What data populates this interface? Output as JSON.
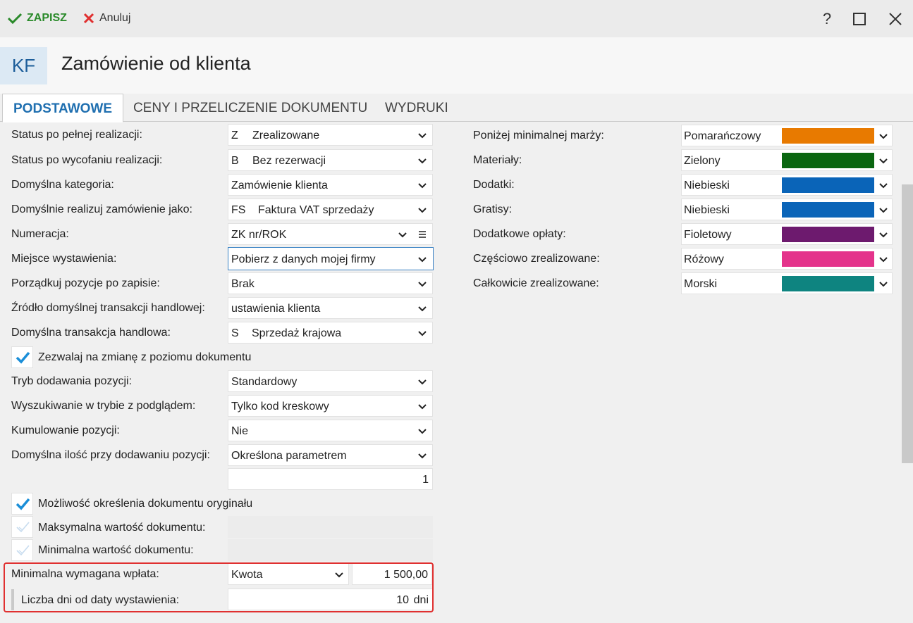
{
  "toolbar": {
    "save_label": "ZAPISZ",
    "cancel_label": "Anuluj",
    "help_label": "?"
  },
  "header": {
    "badge": "KF",
    "title": "Zamówienie od klienta"
  },
  "tabs": [
    {
      "label": "PODSTAWOWE",
      "active": true
    },
    {
      "label": "CENY I PRZELICZENIE DOKUMENTU",
      "active": false
    },
    {
      "label": "WYDRUKI",
      "active": false
    }
  ],
  "left": {
    "status_full": {
      "label": "Status po pełnej realizacji:",
      "code": "Z",
      "value": "Zrealizowane"
    },
    "status_withdraw": {
      "label": "Status po wycofaniu realizacji:",
      "code": "B",
      "value": "Bez rezerwacji"
    },
    "default_category": {
      "label": "Domyślna kategoria:",
      "value": "Zamówienie klienta"
    },
    "realize_as": {
      "label": "Domyślnie realizuj zamówienie jako:",
      "code": "FS",
      "value": "Faktura VAT sprzedaży"
    },
    "numbering": {
      "label": "Numeracja:",
      "value": "ZK nr/ROK"
    },
    "issue_place": {
      "label": "Miejsce wystawienia:",
      "value": "Pobierz z danych mojej firmy"
    },
    "order_positions": {
      "label": "Porządkuj pozycje po zapisie:",
      "value": "Brak"
    },
    "transaction_source": {
      "label": "Źródło domyślnej transakcji handlowej:",
      "value": "ustawienia klienta"
    },
    "default_transaction": {
      "label": "Domyślna transakcja handlowa:",
      "code": "S",
      "value": "Sprzedaż krajowa"
    },
    "allow_change": {
      "label": "Zezwalaj na zmianę z poziomu dokumentu",
      "checked": true
    },
    "add_mode": {
      "label": "Tryb dodawania pozycji:",
      "value": "Standardowy"
    },
    "search_mode": {
      "label": "Wyszukiwanie w trybie z podglądem:",
      "value": "Tylko kod kreskowy"
    },
    "cumulate": {
      "label": "Kumulowanie pozycji:",
      "value": "Nie"
    },
    "default_qty": {
      "label": "Domyślna ilość przy dodawaniu pozycji:",
      "value": "Określona parametrem",
      "param": "1"
    },
    "original_doc": {
      "label": "Możliwość określenia dokumentu oryginału",
      "checked": true
    },
    "max_value": {
      "label": "Maksymalna wartość dokumentu:",
      "checked": false,
      "value": ""
    },
    "min_value": {
      "label": "Minimalna wartość dokumentu:",
      "checked": false,
      "value": ""
    },
    "min_payment": {
      "label": "Minimalna wymagana wpłata:",
      "type": "Kwota",
      "amount": "1 500,00"
    },
    "days_from_issue": {
      "label": "Liczba dni od daty wystawienia:",
      "days": "10",
      "unit": "dni"
    }
  },
  "right": [
    {
      "label": "Poniżej minimalnej marży:",
      "value": "Pomarańczowy",
      "color": "#e87a00"
    },
    {
      "label": "Materiały:",
      "value": "Zielony",
      "color": "#0a6610"
    },
    {
      "label": "Dodatki:",
      "value": "Niebieski",
      "color": "#0a64b8"
    },
    {
      "label": "Gratisy:",
      "value": "Niebieski",
      "color": "#0a64b8"
    },
    {
      "label": "Dodatkowe opłaty:",
      "value": "Fioletowy",
      "color": "#6d1a6e"
    },
    {
      "label": "Częściowo zrealizowane:",
      "value": "Różowy",
      "color": "#e4338b"
    },
    {
      "label": "Całkowicie zrealizowane:",
      "value": "Morski",
      "color": "#0e8480"
    }
  ],
  "icons": {
    "save": "checkmark-icon",
    "cancel": "x-icon",
    "help": "help-icon",
    "maximize": "maximize-icon",
    "close": "close-icon",
    "dropdown": "chevron-down-icon",
    "menu": "menu-icon"
  }
}
